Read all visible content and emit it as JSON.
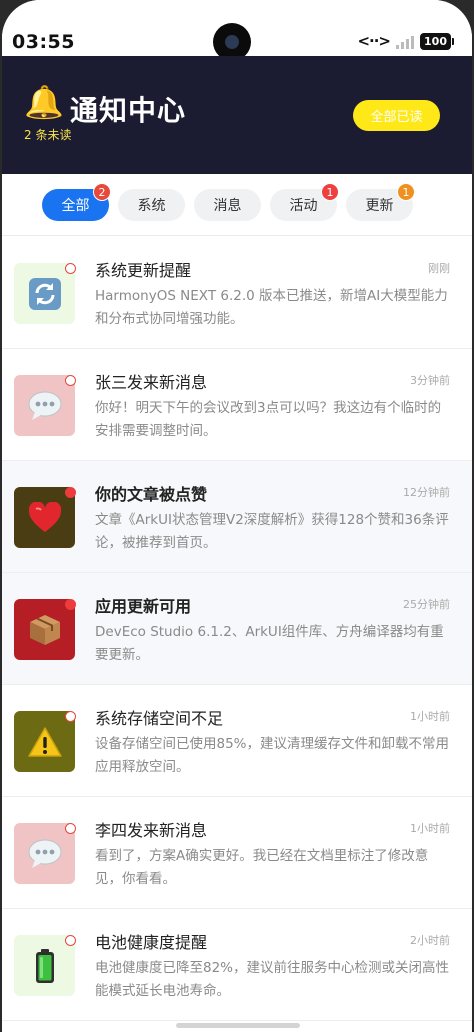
{
  "status_bar": {
    "time": "03:55",
    "net_icon": "data-transfer-icon",
    "signal_icon": "signal-icon",
    "battery": "100"
  },
  "header": {
    "icon": "bell-icon",
    "title": "通知中心",
    "unread_text": "2 条未读",
    "mark_all_label": "全部已读",
    "colors": {
      "background": "#1b1b31",
      "accent": "#ffe818"
    }
  },
  "tabs": [
    {
      "label": "全部",
      "badge": "2",
      "badge_color": "#e8483a",
      "active": true
    },
    {
      "label": "系统",
      "badge": "",
      "active": false
    },
    {
      "label": "消息",
      "badge": "",
      "active": false
    },
    {
      "label": "活动",
      "badge": "1",
      "badge_color": "#ee4040",
      "active": false
    },
    {
      "label": "更新",
      "badge": "1",
      "badge_color": "#f0901e",
      "active": false
    }
  ],
  "notifications": [
    {
      "title": "系统更新提醒",
      "time": "刚刚",
      "body": "HarmonyOS NEXT 6.2.0 版本已推送，新增AI大模型能力和分布式协同增强功能。",
      "icon": "refresh-icon",
      "icon_bg": "#eef9e4",
      "unread": false
    },
    {
      "title": "张三发来新消息",
      "time": "3分钟前",
      "body": "你好！明天下午的会议改到3点可以吗？我这边有个临时的安排需要调整时间。",
      "icon": "chat-bubble-icon",
      "icon_bg": "#f0c4c4",
      "unread": false
    },
    {
      "title": "你的文章被点赞",
      "time": "12分钟前",
      "body": "文章《ArkUI状态管理V2深度解析》获得128个赞和36条评论，被推荐到首页。",
      "icon": "heart-icon",
      "icon_bg": "#4a3d14",
      "unread": true
    },
    {
      "title": "应用更新可用",
      "time": "25分钟前",
      "body": "DevEco Studio 6.1.2、ArkUI组件库、方舟编译器均有重要更新。",
      "icon": "package-icon",
      "icon_bg": "#b41e24",
      "unread": true
    },
    {
      "title": "系统存储空间不足",
      "time": "1小时前",
      "body": "设备存储空间已使用85%，建议清理缓存文件和卸载不常用应用释放空间。",
      "icon": "warning-icon",
      "icon_bg": "#6d6a14",
      "unread": false
    },
    {
      "title": "李四发来新消息",
      "time": "1小时前",
      "body": "看到了，方案A确实更好。我已经在文档里标注了修改意见，你看看。",
      "icon": "chat-bubble-icon",
      "icon_bg": "#f0c4c4",
      "unread": false
    },
    {
      "title": "电池健康度提醒",
      "time": "2小时前",
      "body": "电池健康度已降至82%，建议前往服务中心检测或关闭高性能模式延长电池寿命。",
      "icon": "battery-icon",
      "icon_bg": "#eef9e4",
      "unread": false
    }
  ]
}
